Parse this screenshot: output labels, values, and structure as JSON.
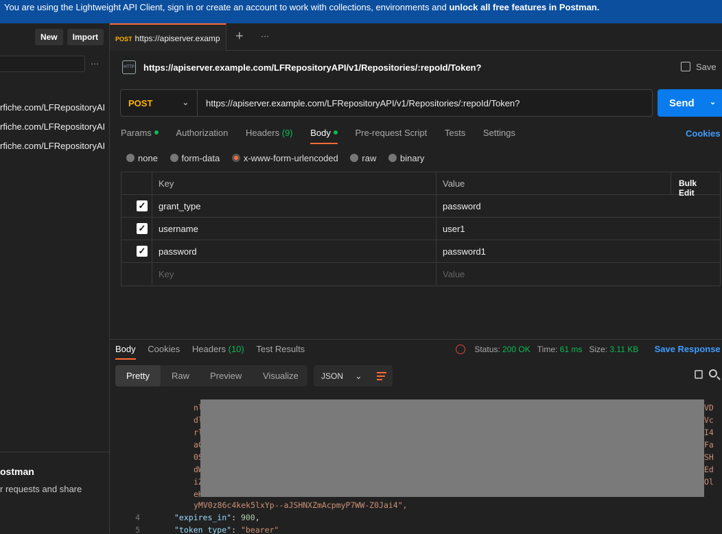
{
  "banner": {
    "text": "You are using the Lightweight API Client, sign in or create an account to work with collections, environments and ",
    "bold": "unlock all free features in Postman."
  },
  "sidebar": {
    "new_label": "New",
    "import_label": "Import",
    "more": "⋯",
    "history": [
      "rfiche.com/LFRepositoryAI",
      "rfiche.com/LFRepositoryAI",
      "rfiche.com/LFRepositoryAI"
    ],
    "footer_title": "ostman",
    "footer_text": "r requests and share"
  },
  "tab": {
    "method": "POST",
    "url": "https://apiserver.examp",
    "plus": "+",
    "more": "⋯"
  },
  "request": {
    "icon": "HTTP",
    "title": "https://apiserver.example.com/LFRepositoryAPI/v1/Repositories/:repoId/Token?",
    "save_label": "Save",
    "method": "POST",
    "url": "https://apiserver.example.com/LFRepositoryAPI/v1/Repositories/:repoId/Token?",
    "send_label": "Send",
    "tabs": {
      "params": "Params",
      "authorization": "Authorization",
      "headers": "Headers",
      "headers_count": "(9)",
      "body": "Body",
      "prerequest": "Pre-request Script",
      "tests": "Tests",
      "settings": "Settings"
    },
    "cookies_label": "Cookies",
    "body_types": [
      "none",
      "form-data",
      "x-www-form-urlencoded",
      "raw",
      "binary"
    ],
    "table": {
      "key_header": "Key",
      "value_header": "Value",
      "bulk_edit": "Bulk Edit",
      "rows": [
        {
          "key": "grant_type",
          "value": "password",
          "checked": true
        },
        {
          "key": "username",
          "value": "user1",
          "checked": true
        },
        {
          "key": "password",
          "value": "password1",
          "checked": true
        }
      ],
      "placeholder_key": "Key",
      "placeholder_value": "Value"
    }
  },
  "response": {
    "tabs": {
      "body": "Body",
      "cookies": "Cookies",
      "headers": "Headers",
      "headers_count": "(10)",
      "test_results": "Test Results"
    },
    "status_label": "Status:",
    "status": "200 OK",
    "time_label": "Time:",
    "time": "61 ms",
    "size_label": "Size:",
    "size": "3.11 KB",
    "save_response": "Save Response",
    "formats": [
      "Pretty",
      "Raw",
      "Preview",
      "Visualize"
    ],
    "json_label": "JSON",
    "code": {
      "left_edge": [
        "nl",
        "dl",
        "rl",
        "aC",
        "0S",
        "dW",
        "iZ",
        "eH"
      ],
      "right_edge": [
        "VD",
        "Vc",
        "I4",
        "Fa",
        "SH",
        "Ed",
        "Ol",
        ""
      ],
      "token_tail": "yMV0z86c4kek5lxYp--aJSHNXZmAcpmyP7WW-Z0Jai4\",",
      "line4_num": "4",
      "line4_key": "\"expires_in\"",
      "line4_val": "900",
      "line5_num": "5",
      "line5_key": "\"token_type\"",
      "line5_val": "\"bearer\""
    }
  },
  "colors": {
    "accent": "#ff6c37",
    "primary": "#097bed",
    "success": "#0cbb52",
    "method": "#ffb400"
  }
}
